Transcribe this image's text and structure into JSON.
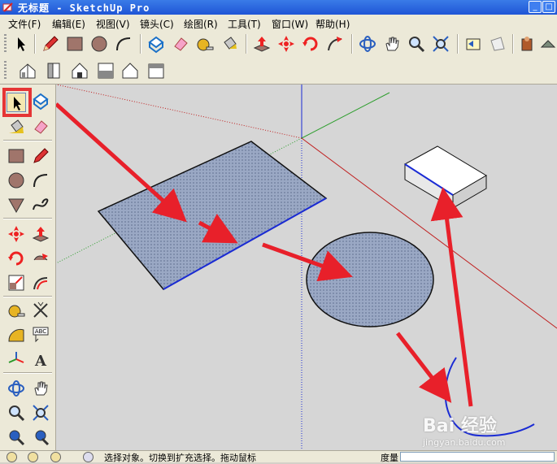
{
  "window": {
    "title": "无标题 - SketchUp Pro"
  },
  "menu": [
    {
      "label": "文件(F)"
    },
    {
      "label": "编辑(E)"
    },
    {
      "label": "视图(V)"
    },
    {
      "label": "镜头(C)"
    },
    {
      "label": "绘图(R)"
    },
    {
      "label": "工具(T)"
    },
    {
      "label": "窗口(W)"
    },
    {
      "label": "帮助(H)"
    }
  ],
  "toolbar_top": [
    "select-tool",
    "pencil-line-tool",
    "rectangle-tool",
    "circle-tool",
    "arc-tool",
    "make-component-tool",
    "eraser-tool",
    "tape-measure-tool",
    "paint-bucket-tool",
    "push-pull-tool",
    "move-tool",
    "rotate-tool",
    "follow-me-tool",
    "orbit-tool",
    "pan-tool",
    "zoom-tool",
    "zoom-extents-tool",
    "previous-view-tool",
    "next-view-tool",
    "warehouse-tool",
    "extension-tool"
  ],
  "toolbar_views": [
    "iso-view",
    "top-view",
    "front-view",
    "right-view",
    "back-view",
    "left-view"
  ],
  "status": {
    "text": "选择对象。切换到扩充选择。拖动鼠标",
    "vcb_label": "度量"
  },
  "watermark": {
    "main": "Bai 经验",
    "sub": "jingyan.baidu.com"
  },
  "colors": {
    "accent_red": "#e53535",
    "selection_blue": "#1a2bd4",
    "face_fill": "#9aa8c4"
  }
}
